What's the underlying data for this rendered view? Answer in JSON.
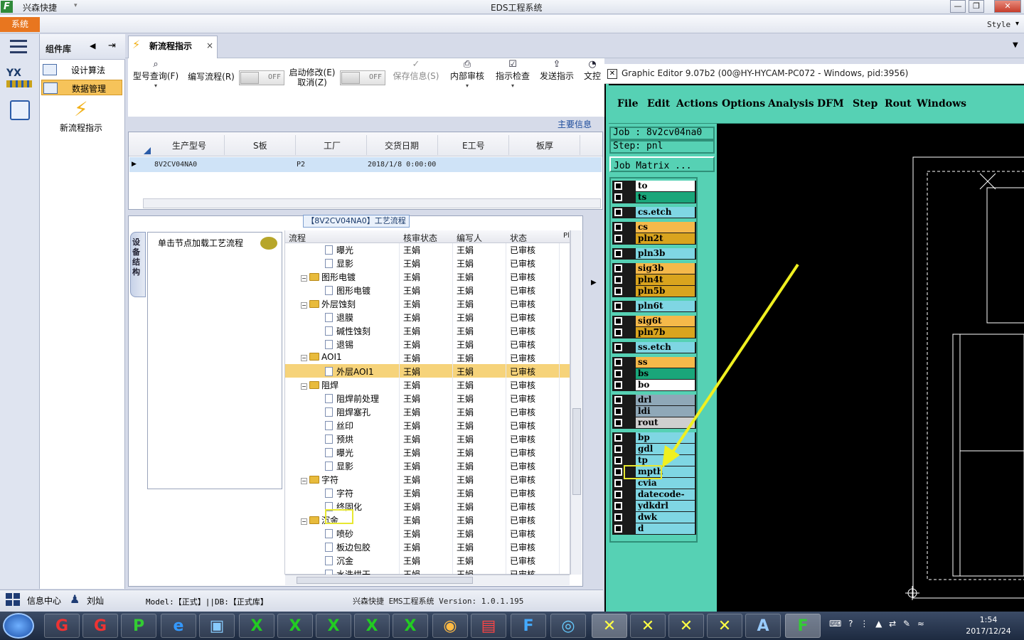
{
  "window": {
    "app_name": "兴森快捷",
    "title": "EDS工程系统",
    "style_label": "Style"
  },
  "menubar": {
    "system_tab": "系统"
  },
  "nav": {
    "title": "组件库",
    "items": [
      {
        "label": "设计算法"
      },
      {
        "label": "数据管理"
      }
    ],
    "flow_label": "新流程指示",
    "yx_label": "YX"
  },
  "doc_tab": {
    "label": "新流程指示",
    "close": "×"
  },
  "toolbar": {
    "model_query": "型号查询(F)",
    "edit_flow": "编写流程(R)",
    "toggle_off": "OFF",
    "start_modify": "启动修改(E)",
    "cancel": "取消(Z)",
    "save_info": "保存信息(S)",
    "internal_review": "内部审核",
    "check": "指示检查",
    "send": "发送指示",
    "doc": "文控"
  },
  "main_info": "主要信息",
  "grid1": {
    "headers": [
      "生产型号",
      "S板",
      "工厂",
      "交货日期",
      "E工号",
      "板厚"
    ],
    "row": {
      "model": "8V2CV04NA0",
      "factory": "P2",
      "date": "2018/1/8 0:00:00"
    }
  },
  "flow": {
    "caption": "【8V2CV04NA0】工艺流程",
    "side_tab": "设备结构",
    "load_hint": "单击节点加载工艺流程",
    "headers": [
      "流程",
      "核审状态",
      "编写人",
      "状态",
      "Pl"
    ],
    "rows": [
      {
        "name": "曝光",
        "level": 2,
        "folder": false,
        "reviewer": "王娟",
        "writer": "王娟",
        "status": "已审核"
      },
      {
        "name": "显影",
        "level": 2,
        "folder": false,
        "reviewer": "王娟",
        "writer": "王娟",
        "status": "已审核"
      },
      {
        "name": "图形电镀",
        "level": 1,
        "folder": true,
        "reviewer": "王娟",
        "writer": "王娟",
        "status": "已审核"
      },
      {
        "name": "图形电镀",
        "level": 2,
        "folder": false,
        "reviewer": "王娟",
        "writer": "王娟",
        "status": "已审核"
      },
      {
        "name": "外层蚀刻",
        "level": 1,
        "folder": true,
        "reviewer": "王娟",
        "writer": "王娟",
        "status": "已审核"
      },
      {
        "name": "退膜",
        "level": 2,
        "folder": false,
        "reviewer": "王娟",
        "writer": "王娟",
        "status": "已审核"
      },
      {
        "name": "碱性蚀刻",
        "level": 2,
        "folder": false,
        "reviewer": "王娟",
        "writer": "王娟",
        "status": "已审核"
      },
      {
        "name": "退锡",
        "level": 2,
        "folder": false,
        "reviewer": "王娟",
        "writer": "王娟",
        "status": "已审核"
      },
      {
        "name": "AOI1",
        "level": 1,
        "folder": true,
        "reviewer": "王娟",
        "writer": "王娟",
        "status": "已审核"
      },
      {
        "name": "外层AOI1",
        "level": 2,
        "folder": false,
        "reviewer": "王娟",
        "writer": "王娟",
        "status": "已审核",
        "selected": true
      },
      {
        "name": "阻焊",
        "level": 1,
        "folder": true,
        "reviewer": "王娟",
        "writer": "王娟",
        "status": "已审核"
      },
      {
        "name": "阻焊前处理",
        "level": 2,
        "folder": false,
        "reviewer": "王娟",
        "writer": "王娟",
        "status": "已审核"
      },
      {
        "name": "阻焊塞孔",
        "level": 2,
        "folder": false,
        "reviewer": "王娟",
        "writer": "王娟",
        "status": "已审核"
      },
      {
        "name": "丝印",
        "level": 2,
        "folder": false,
        "reviewer": "王娟",
        "writer": "王娟",
        "status": "已审核"
      },
      {
        "name": "预烘",
        "level": 2,
        "folder": false,
        "reviewer": "王娟",
        "writer": "王娟",
        "status": "已审核"
      },
      {
        "name": "曝光",
        "level": 2,
        "folder": false,
        "reviewer": "王娟",
        "writer": "王娟",
        "status": "已审核"
      },
      {
        "name": "显影",
        "level": 2,
        "folder": false,
        "reviewer": "王娟",
        "writer": "王娟",
        "status": "已审核"
      },
      {
        "name": "字符",
        "level": 1,
        "folder": true,
        "reviewer": "王娟",
        "writer": "王娟",
        "status": "已审核"
      },
      {
        "name": "字符",
        "level": 2,
        "folder": false,
        "reviewer": "王娟",
        "writer": "王娟",
        "status": "已审核"
      },
      {
        "name": "终固化",
        "level": 2,
        "folder": false,
        "reviewer": "王娟",
        "writer": "王娟",
        "status": "已审核"
      },
      {
        "name": "沉金",
        "level": 1,
        "folder": true,
        "reviewer": "王娟",
        "writer": "王娟",
        "status": "已审核"
      },
      {
        "name": "喷砂",
        "level": 2,
        "folder": false,
        "reviewer": "王娟",
        "writer": "王娟",
        "status": "已审核"
      },
      {
        "name": "板边包胶",
        "level": 2,
        "folder": false,
        "reviewer": "王娟",
        "writer": "王娟",
        "status": "已审核"
      },
      {
        "name": "沉金",
        "level": 2,
        "folder": false,
        "reviewer": "王娟",
        "writer": "王娟",
        "status": "已审核"
      },
      {
        "name": "水洗烘干",
        "level": 2,
        "folder": false,
        "reviewer": "王娟",
        "writer": "王娟",
        "status": "已审核"
      }
    ]
  },
  "status": {
    "info_center": "信息中心",
    "user": "刘灿",
    "model_db": "Model:【正式】||DB:【正式库】",
    "version": "兴森快捷 EMS工程系统 Version: 1.0.1.195"
  },
  "graphic_editor": {
    "title": "Graphic Editor 9.07b2 (00@HY-HYCAM-PC072 - Windows, pid:3956)",
    "menu": [
      "File",
      "Edit",
      "Actions",
      "Options",
      "Analysis",
      "DFM",
      "Step",
      "Rout",
      "Windows"
    ],
    "job": "Job : 8v2cv04na0",
    "step": "Step: pnl",
    "job_matrix": "Job Matrix ...",
    "layers": [
      {
        "name": "to",
        "color": "#ffffff"
      },
      {
        "name": "ts",
        "color": "#1aa67a"
      },
      {
        "name": "cs.etch",
        "color": "#7fd6e3"
      },
      {
        "name": "cs",
        "color": "#f5b94a"
      },
      {
        "name": "pln2t",
        "color": "#d9a41e"
      },
      {
        "name": "pln3b",
        "color": "#7fd6e3"
      },
      {
        "name": "sig3b",
        "color": "#f5b94a"
      },
      {
        "name": "pln4t",
        "color": "#d9a41e"
      },
      {
        "name": "pln5b",
        "color": "#d9a41e"
      },
      {
        "name": "pln6t",
        "color": "#7fd6e3"
      },
      {
        "name": "sig6t",
        "color": "#f5b94a"
      },
      {
        "name": "pln7b",
        "color": "#d9a41e"
      },
      {
        "name": "ss.etch",
        "color": "#7fd6e3"
      },
      {
        "name": "ss",
        "color": "#f5b94a"
      },
      {
        "name": "bs",
        "color": "#1aa67a"
      },
      {
        "name": "bo",
        "color": "#ffffff"
      },
      {
        "name": "drl",
        "color": "#8fa8b8"
      },
      {
        "name": "ldi",
        "color": "#8fa8b8"
      },
      {
        "name": "rout",
        "color": "#cfcfcf"
      },
      {
        "name": "bp",
        "color": "#7fd6e3"
      },
      {
        "name": "gdl",
        "color": "#7fd6e3"
      },
      {
        "name": "tp",
        "color": "#7fd6e3"
      },
      {
        "name": "mpth",
        "color": "#7fd6e3"
      },
      {
        "name": "cvia",
        "color": "#7fd6e3"
      },
      {
        "name": "datecode-bs",
        "color": "#7fd6e3"
      },
      {
        "name": "ydkdrl",
        "color": "#7fd6e3"
      },
      {
        "name": "dwk",
        "color": "#7fd6e3"
      },
      {
        "name": "d",
        "color": "#7fd6e3"
      }
    ]
  },
  "taskbar": {
    "time": "1:54",
    "date": "2017/12/24"
  }
}
